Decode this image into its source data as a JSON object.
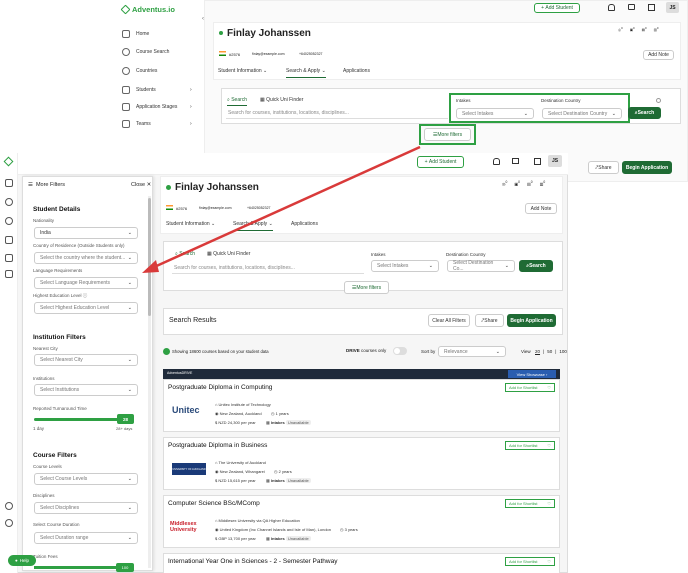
{
  "bg": {
    "brand": "Adventus.io",
    "nav": [
      "Home",
      "Course Search",
      "Countries",
      "Students",
      "Application Stages",
      "Teams"
    ],
    "add_student": "Add Student",
    "avatar": "JS",
    "student_name": "Finlay Johanssen",
    "student_id": "#2576",
    "email": "finlay@example.com",
    "phone": "+64025052327",
    "add_note": "Add Note",
    "tabs": [
      "Student Information",
      "Search & Apply",
      "Applications"
    ],
    "search_tab": "Search",
    "quick_tab": "Quick Uni Finder",
    "search_placeholder": "Search for courses, institutions, locations, disciplines...",
    "intakes_label": "Intakes",
    "intakes_placeholder": "Select Intakes",
    "dest_label": "Destination Country",
    "dest_placeholder": "Select Destination Country",
    "search_btn": "Search",
    "more_filters": "More filters",
    "share": "Share",
    "begin": "Begin Application",
    "counts": [
      "0",
      "0",
      "0",
      "0"
    ]
  },
  "fg": {
    "add_student": "Add Student",
    "avatar": "JS",
    "student_name": "Finlay Johanssen",
    "student_id": "#2576",
    "email": "finlay@example.com",
    "phone": "+64025052327",
    "add_note": "Add Note",
    "tabs": [
      "Student Information",
      "Search & Apply",
      "Applications"
    ],
    "search_tab": "Search",
    "quick_tab": "Quick Uni Finder",
    "search_placeholder": "Search for courses, institutions, locations, disciplines...",
    "intakes_label": "Intakes",
    "intakes_placeholder": "Select Intakes",
    "dest_label": "Destination Country",
    "dest_placeholder": "Select Destination Co...",
    "search_btn": "Search",
    "more_filters": "More filters",
    "results_title": "Search Results",
    "clear_all": "Clear All Filters",
    "share": "Share",
    "begin": "Begin Application",
    "showing": "Showing 18600 courses based on your student data",
    "drive_label": "DRIVE",
    "drive_only": "courses only",
    "sort_label": "Sort by",
    "sort_value": "Relevance",
    "view_label": "View",
    "view_options": [
      "20",
      "50",
      "100"
    ],
    "adventus_drive": "AdventusDRIVE",
    "view_showcase": "View Showcase",
    "add_shortlist": "Add for Shortlist",
    "intakes_word": "Intakes",
    "unavailable": "Unavailable",
    "help": "Help",
    "counts": [
      "0",
      "0",
      "0",
      "0"
    ],
    "cards": [
      {
        "title": "Postgraduate Diploma in Computing",
        "logo": "Unitec",
        "inst": "Unitec Institute of Technology",
        "loc": "New Zealand, Auckland",
        "dur": "1 years",
        "fee": "NZD 24,300 per year"
      },
      {
        "title": "Postgraduate Diploma in Business",
        "logo": "UNIVERSITY OF AUCKLAND",
        "inst": "The University of Auckland",
        "loc": "New Zealand, Whangarei",
        "dur": "2 years",
        "fee": "NZD 15,615 per year"
      },
      {
        "title": "Computer Science BSc/MComp",
        "logo": "Middlesex University",
        "inst": "Middlesex University via QA Higher Education",
        "loc": "United Kingdom (Inc Channel Islands and Isle of Man), London",
        "dur": "3 years",
        "fee": "GBP 13,700 per year"
      },
      {
        "title": "International Year One in Sciences - 2 - Semester Pathway",
        "logo": "",
        "inst": "",
        "loc": "",
        "dur": "",
        "fee": ""
      }
    ]
  },
  "filters": {
    "title": "More Filters",
    "close": "Close",
    "student_details": "Student Details",
    "nationality_label": "Nationality",
    "nationality_value": "India",
    "residence_label": "Country of Residence (Outside Students only)",
    "residence_placeholder": "Select the country where the student...",
    "lang_label": "Language Requirements",
    "lang_placeholder": "Select Language Requirements",
    "edu_label": "Highest Education Level",
    "edu_placeholder": "Select Highest Education Level",
    "inst_filters": "Institution Filters",
    "city_label": "Nearest City",
    "city_placeholder": "Select Nearest City",
    "insts_label": "Institutions",
    "insts_placeholder": "Select Institutions",
    "turnaround_label": "Reported Turnaround Time",
    "turnaround_value": "28",
    "turnaround_min": "1 day",
    "turnaround_max": "28+ days",
    "course_filters": "Course Filters",
    "levels_label": "Course Levels",
    "levels_placeholder": "Select Course Levels",
    "disc_label": "Disciplines",
    "disc_placeholder": "Select Disciplines",
    "duration_label": "Select Course Duration",
    "duration_placeholder": "Select Duration range",
    "tuition_label": "Tuition Fees",
    "tuition_value": "100"
  },
  "colors": {
    "accent": "#1f6b34",
    "highlight": "#2ea043",
    "arrow": "#d93a3a"
  }
}
